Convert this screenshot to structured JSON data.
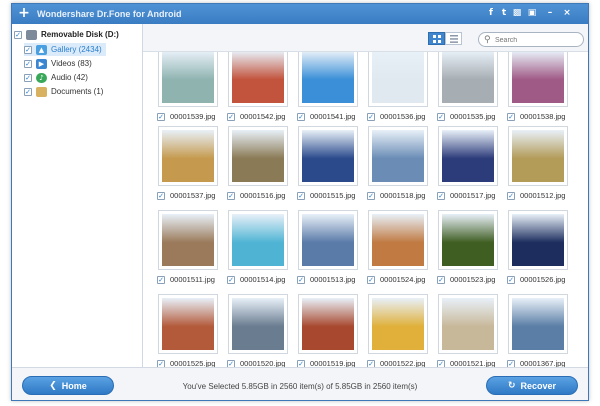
{
  "window": {
    "title": "Wondershare Dr.Fone for Android"
  },
  "titlebar": {
    "icons": [
      "facebook-icon",
      "twitter-icon",
      "feedback-icon",
      "register-icon",
      "minimize-icon",
      "close-icon"
    ]
  },
  "sidebar": {
    "root": {
      "label": "Removable Disk (D:)",
      "checked": true
    },
    "items": [
      {
        "label": "Gallery (2434)",
        "checked": true,
        "icon": "gallery-icon",
        "color": "#4a9fe0",
        "selected": true
      },
      {
        "label": "Videos (83)",
        "checked": true,
        "icon": "video-icon",
        "color": "#3a86d0"
      },
      {
        "label": "Audio (42)",
        "checked": true,
        "icon": "audio-icon",
        "color": "#3aa85a"
      },
      {
        "label": "Documents (1)",
        "checked": true,
        "icon": "folder-icon",
        "color": "#d8b260"
      }
    ]
  },
  "toolbar": {
    "search_placeholder": "Search",
    "view_mode": "grid"
  },
  "files": [
    [
      "00001539.jpg",
      "00001542.jpg",
      "00001541.jpg",
      "00001536.jpg",
      "00001535.jpg",
      "00001538.jpg"
    ],
    [
      "00001537.jpg",
      "00001516.jpg",
      "00001515.jpg",
      "00001518.jpg",
      "00001517.jpg",
      "00001512.jpg"
    ],
    [
      "00001511.jpg",
      "00001514.jpg",
      "00001513.jpg",
      "00001524.jpg",
      "00001523.jpg",
      "00001526.jpg"
    ],
    [
      "00001525.jpg",
      "00001520.jpg",
      "00001519.jpg",
      "00001522.jpg",
      "00001521.jpg",
      "00001367.jpg"
    ]
  ],
  "thumb_colors": [
    [
      "#8fb4b0",
      "#c2533c",
      "#3a8fd8",
      "#dfe9ef",
      "#a7aeb3",
      "#a05a86"
    ],
    [
      "#c59a4e",
      "#8a7a55",
      "#2a4a8c",
      "#6a8cb5",
      "#2c3b7a",
      "#b39b58"
    ],
    [
      "#9a7a5a",
      "#4fb4d4",
      "#5a7aa8",
      "#c07a42",
      "#3f5e22",
      "#1c2d5e"
    ],
    [
      "#b35a3a",
      "#6a7c90",
      "#a8492f",
      "#e0b03a",
      "#c8b89a",
      "#5a7ea5"
    ]
  ],
  "status": {
    "text": "You've Selected 5.85GB in 2560 item(s) of 5.85GB in 2560 item(s)"
  },
  "buttons": {
    "home": "Home",
    "recover": "Recover"
  }
}
